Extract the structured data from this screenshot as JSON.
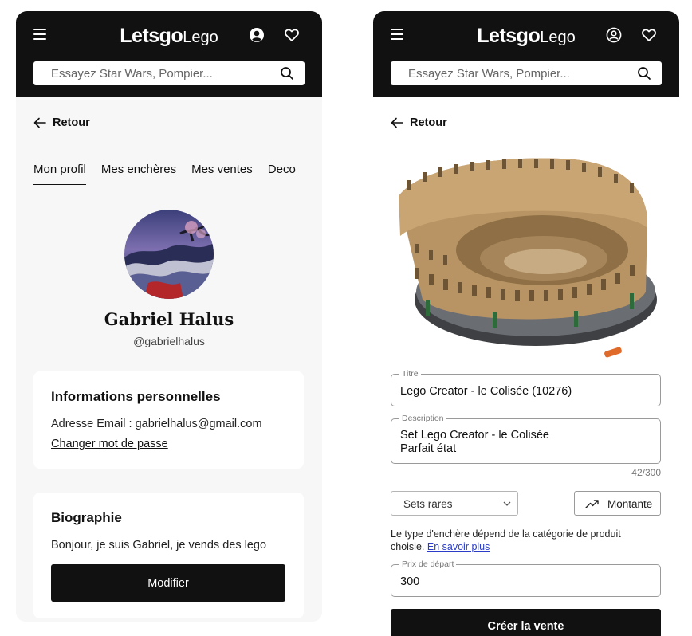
{
  "header": {
    "brand_bold": "Letsgo",
    "brand_light": "Lego",
    "search_placeholder": "Essayez Star Wars, Pompier..."
  },
  "back_label": "Retour",
  "profile": {
    "tabs": [
      "Mon profil",
      "Mes enchères",
      "Mes ventes",
      "Deco"
    ],
    "name": "Gabriel Halus",
    "handle": "@gabrielhalus",
    "info_card": {
      "title": "Informations personnelles",
      "email_text": "Adresse Email : gabrielhalus@gmail.com",
      "change_password": "Changer mot de passe"
    },
    "bio_card": {
      "title": "Biographie",
      "text": "Bonjour, je suis Gabriel, je vends des lego",
      "button": "Modifier"
    }
  },
  "sale_form": {
    "title_label": "Titre",
    "title_value": "Lego Creator - le Colisée (10276)",
    "description_label": "Description",
    "description_value": "Set Lego Creator - le Colisée\nParfait état",
    "description_counter": "42/300",
    "category_value": "Sets rares",
    "auction_type": "Montante",
    "help_text": "Le type d'enchère dépend de la catégorie de produit choisie.",
    "help_link": "En savoir plus",
    "price_label": "Prix de départ",
    "price_value": "300",
    "submit": "Créer la vente"
  },
  "colors": {
    "header_bg": "#111111",
    "page_bg": "#f7f7f7",
    "link_blue": "#2a3cc8"
  },
  "icons": [
    "menu-icon",
    "user-icon",
    "heart-icon",
    "search-icon",
    "arrow-left-icon",
    "trending-up-icon",
    "chevron-down-icon"
  ]
}
